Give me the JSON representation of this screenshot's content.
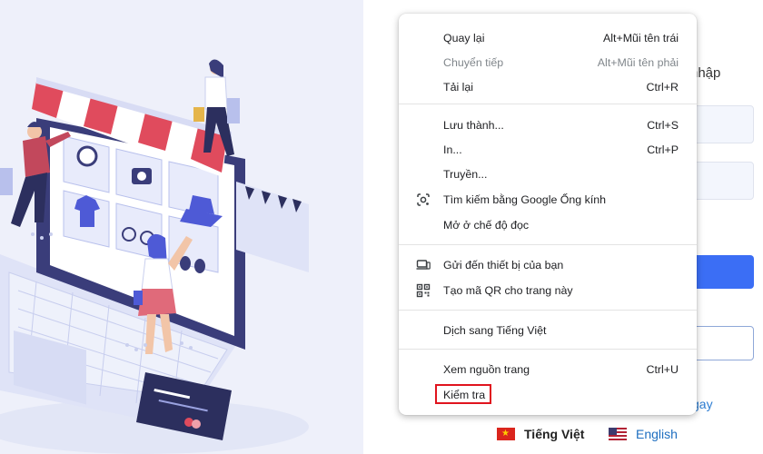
{
  "login": {
    "title_fragment": "nhập",
    "link_fragment": "gay"
  },
  "languages": [
    {
      "label": "Tiếng Việt",
      "flag": "vn-flag-icon"
    },
    {
      "label": "English",
      "flag": "us-flag-icon"
    }
  ],
  "menu": {
    "items": [
      {
        "label": "Quay lại",
        "shortcut": "Alt+Mũi tên trái",
        "disabled": false
      },
      {
        "label": "Chuyển tiếp",
        "shortcut": "Alt+Mũi tên phải",
        "disabled": true
      },
      {
        "label": "Tải lại",
        "shortcut": "Ctrl+R",
        "disabled": false
      },
      {
        "label": "Lưu thành...",
        "shortcut": "Ctrl+S",
        "disabled": false
      },
      {
        "label": "In...",
        "shortcut": "Ctrl+P",
        "disabled": false
      },
      {
        "label": "Truyền...",
        "shortcut": "",
        "disabled": false
      },
      {
        "label": "Tìm kiếm bằng Google Ống kính",
        "shortcut": "",
        "icon": "google-lens-icon"
      },
      {
        "label": "Mở ở chế độ đọc",
        "shortcut": ""
      },
      {
        "label": "Gửi đến thiết bị của bạn",
        "shortcut": "",
        "icon": "send-to-device-icon"
      },
      {
        "label": "Tạo mã QR cho trang này",
        "shortcut": "",
        "icon": "qr-code-icon"
      },
      {
        "label": "Dịch sang Tiếng Việt",
        "shortcut": ""
      },
      {
        "label": "Xem nguồn trang",
        "shortcut": "Ctrl+U"
      },
      {
        "label": "Kiểm tra",
        "shortcut": "",
        "highlighted": true
      }
    ]
  },
  "colors": {
    "accent_blue": "#3b6ef5",
    "highlight_red": "#e0141e",
    "illustration_bg": "#eef0fa"
  }
}
